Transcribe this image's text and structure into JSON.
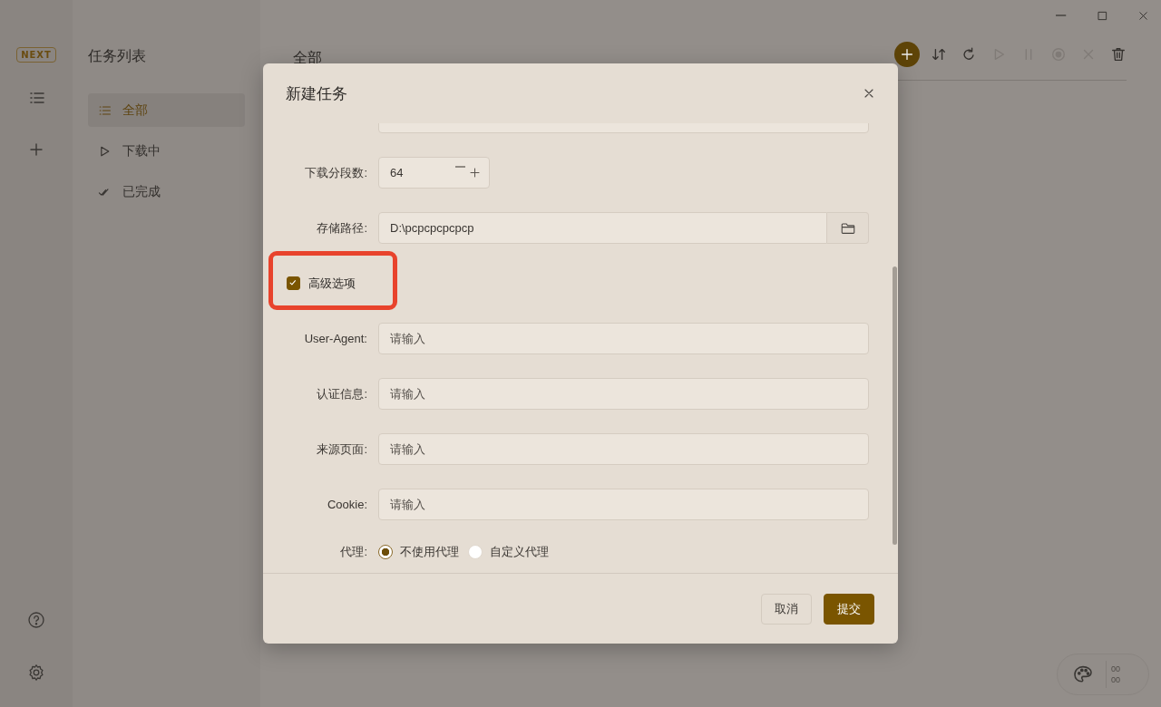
{
  "rail": {
    "logo": "NEXT"
  },
  "task_panel": {
    "title": "任务列表",
    "items": [
      {
        "label": "全部",
        "selected": true
      },
      {
        "label": "下载中",
        "selected": false
      },
      {
        "label": "已完成",
        "selected": false
      }
    ]
  },
  "main": {
    "title": "全部",
    "toolbar": [
      {
        "disabled": false
      },
      {
        "disabled": false
      },
      {
        "disabled": false
      },
      {
        "disabled": true
      },
      {
        "disabled": true
      },
      {
        "disabled": true
      },
      {
        "disabled": true
      },
      {
        "disabled": false
      }
    ]
  },
  "dialog": {
    "title": "新建任务",
    "fields": [
      {
        "kind": "stepper",
        "label": "下载分段数:",
        "value": "64"
      },
      {
        "kind": "path",
        "label": "存储路径:",
        "value": "D:\\pcpcpcpcpcp"
      },
      {
        "kind": "checkbox",
        "label": "高级选项",
        "checked": true,
        "highlighted": true
      },
      {
        "kind": "text",
        "label": "User-Agent:",
        "placeholder": "请输入"
      },
      {
        "kind": "text",
        "label": "认证信息:",
        "placeholder": "请输入"
      },
      {
        "kind": "text",
        "label": "来源页面:",
        "placeholder": "请输入"
      },
      {
        "kind": "text",
        "label": "Cookie:",
        "placeholder": "请输入"
      },
      {
        "kind": "radio",
        "label": "代理:",
        "options": [
          {
            "label": "不使用代理",
            "selected": true
          },
          {
            "label": "自定义代理",
            "selected": false
          }
        ]
      }
    ],
    "buttons": [
      {
        "label": "取消",
        "kind": "secondary"
      },
      {
        "label": "提交",
        "kind": "primary"
      }
    ]
  },
  "theme_widget": {
    "readings": [
      "00",
      "00"
    ]
  }
}
